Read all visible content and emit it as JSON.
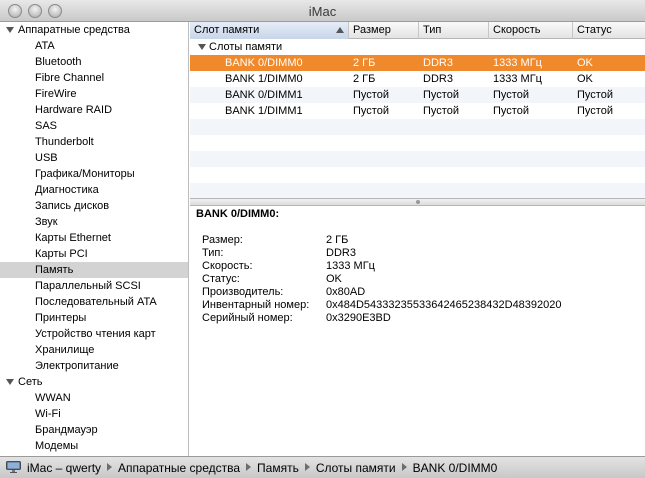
{
  "window": {
    "title": "iMac"
  },
  "sidebar": {
    "groups": [
      {
        "label": "Аппаратные средства",
        "items": [
          "ATA",
          "Bluetooth",
          "Fibre Channel",
          "FireWire",
          "Hardware RAID",
          "SAS",
          "Thunderbolt",
          "USB",
          "Графика/Мониторы",
          "Диагностика",
          "Запись дисков",
          "Звук",
          "Карты Ethernet",
          "Карты PCI",
          "Память",
          "Параллельный SCSI",
          "Последовательный ATA",
          "Принтеры",
          "Устройство чтения карт",
          "Хранилище",
          "Электропитание"
        ]
      },
      {
        "label": "Сеть",
        "items": [
          "WWAN",
          "Wi-Fi",
          "Брандмауэр",
          "Модемы"
        ]
      }
    ],
    "selected": "Память"
  },
  "table": {
    "columns": [
      "Слот памяти",
      "Размер",
      "Тип",
      "Скорость",
      "Статус"
    ],
    "sorted_column": "Слот памяти",
    "group_label": "Слоты памяти",
    "rows": [
      [
        "BANK 0/DIMM0",
        "2 ГБ",
        "DDR3",
        "1333 МГц",
        "OK"
      ],
      [
        "BANK 1/DIMM0",
        "2 ГБ",
        "DDR3",
        "1333 МГц",
        "OK"
      ],
      [
        "BANK 0/DIMM1",
        "Пустой",
        "Пустой",
        "Пустой",
        "Пустой"
      ],
      [
        "BANK 1/DIMM1",
        "Пустой",
        "Пустой",
        "Пустой",
        "Пустой"
      ]
    ],
    "selected_row": 0
  },
  "detail": {
    "title": "BANK 0/DIMM0:",
    "fields": [
      {
        "label": "Размер:",
        "value": "2 ГБ"
      },
      {
        "label": "Тип:",
        "value": "DDR3"
      },
      {
        "label": "Скорость:",
        "value": "1333 МГц"
      },
      {
        "label": "Статус:",
        "value": "OK"
      },
      {
        "label": "Производитель:",
        "value": "0x80AD"
      },
      {
        "label": "Инвентарный номер:",
        "value": "0x484D54333235533642465238432D48392020"
      },
      {
        "label": "Серийный номер:",
        "value": "0x3290E3BD"
      }
    ]
  },
  "statusbar": {
    "icon": "imac-icon",
    "breadcrumb": [
      "iMac – qwerty",
      "Аппаратные средства",
      "Память",
      "Слоты памяти",
      "BANK 0/DIMM0"
    ]
  },
  "colors": {
    "selection": "#f0892b",
    "sidebar_selection": "#d3d3d3",
    "alt_row": "#f2f5fa"
  }
}
